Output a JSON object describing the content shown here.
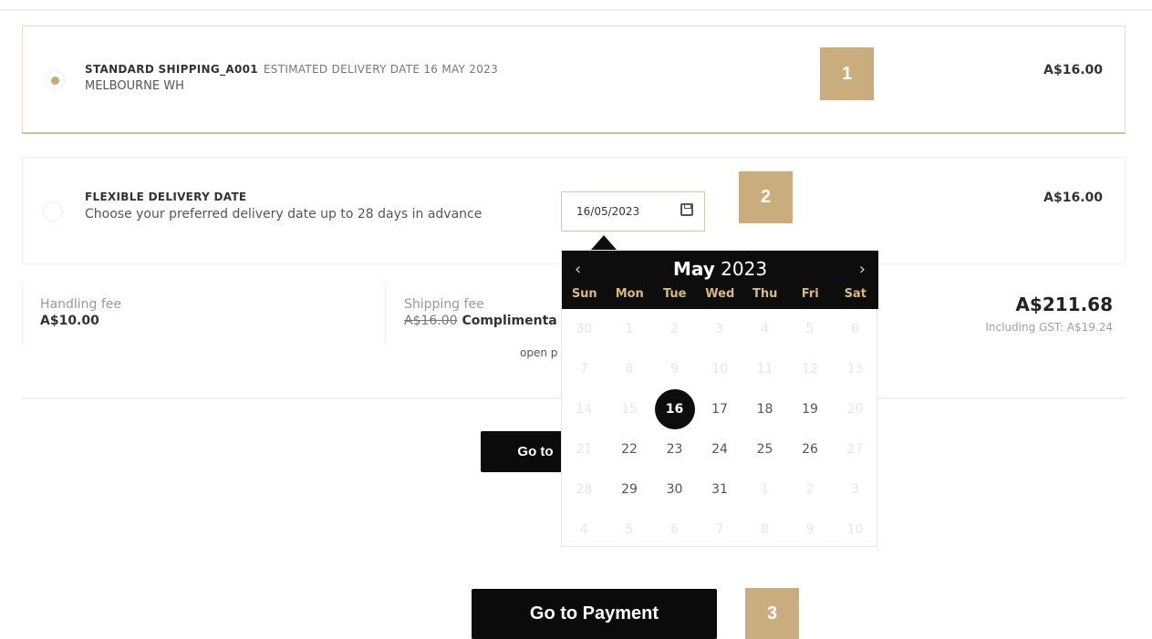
{
  "shipping_options": [
    {
      "title": "STANDARD SHIPPING_A001",
      "estimate": "ESTIMATED DELIVERY DATE 16 MAY 2023",
      "subtitle": "MELBOURNE WH",
      "price": "A$16.00",
      "selected": true
    },
    {
      "title": "FLEXIBLE DELIVERY DATE",
      "subtitle": "Choose your preferred delivery date up to 28 days in advance",
      "price": "A$16.00",
      "selected": false,
      "date_value": "16/05/2023"
    }
  ],
  "badges": [
    "1",
    "2",
    "3"
  ],
  "summary": {
    "handling_label": "Handling fee",
    "handling_value": "A$10.00",
    "shipping_label": "Shipping fee",
    "shipping_old": "A$16.00",
    "shipping_value": "Complimenta",
    "open_text": "open p",
    "total": "A$211.68",
    "gst": "Including GST: A$19.24"
  },
  "buttons": {
    "hidden_label": "Go to",
    "payment_label": "Go to Payment"
  },
  "datepicker": {
    "prev": "‹",
    "next": "›",
    "month": "May",
    "year": "2023",
    "weekdays": [
      "Sun",
      "Mon",
      "Tue",
      "Wed",
      "Thu",
      "Fri",
      "Sat"
    ],
    "weeks": [
      [
        "30",
        "1",
        "2",
        "3",
        "4",
        "5",
        "6"
      ],
      [
        "7",
        "8",
        "9",
        "10",
        "11",
        "12",
        "13"
      ],
      [
        "14",
        "15",
        "16",
        "17",
        "18",
        "19",
        "20"
      ],
      [
        "21",
        "22",
        "23",
        "24",
        "25",
        "26",
        "27"
      ],
      [
        "28",
        "29",
        "30",
        "31",
        "1",
        "2",
        "3"
      ],
      [
        "4",
        "5",
        "6",
        "7",
        "8",
        "9",
        "10"
      ]
    ],
    "selected_day": "16",
    "enabled_days": [
      "16",
      "17",
      "18",
      "19",
      "22",
      "23",
      "24",
      "25",
      "26",
      "29",
      "30",
      "31"
    ]
  },
  "colors": {
    "accent": "#c9ad7e",
    "dark": "#0d0d0d",
    "weekday": "#d8b97c"
  }
}
